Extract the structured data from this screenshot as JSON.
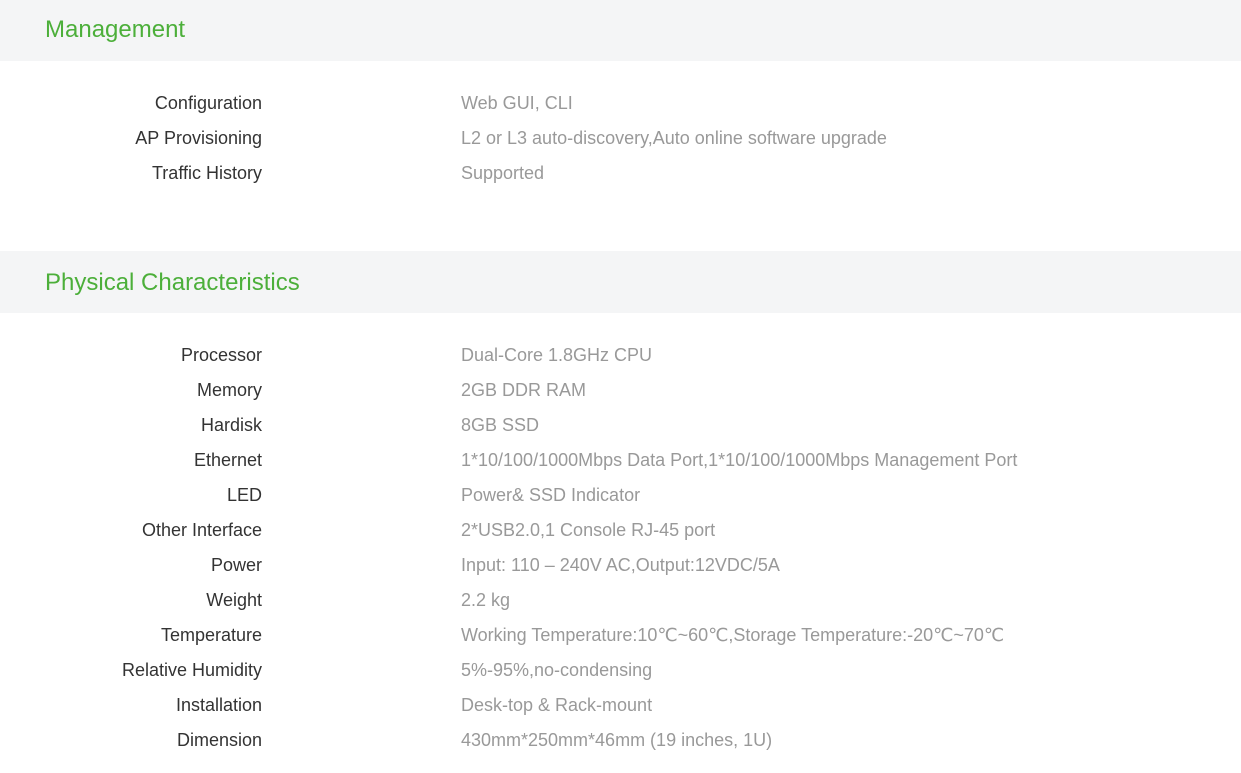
{
  "management": {
    "title": "Management",
    "rows": [
      {
        "label": "Configuration",
        "value": "Web GUI, CLI"
      },
      {
        "label": "AP Provisioning",
        "value": "L2 or L3 auto-discovery,Auto online software  upgrade"
      },
      {
        "label": "Traffic History",
        "value": "Supported"
      }
    ]
  },
  "physical": {
    "title": "Physical Characteristics",
    "rows": [
      {
        "label": "Processor",
        "value": "Dual-Core 1.8GHz CPU"
      },
      {
        "label": "Memory",
        "value": "2GB DDR RAM"
      },
      {
        "label": "Hardisk",
        "value": "8GB SSD"
      },
      {
        "label": "Ethernet",
        "value": "1*10/100/1000Mbps Data Port,1*10/100/1000Mbps Management Port"
      },
      {
        "label": "LED",
        "value": "Power& SSD Indicator"
      },
      {
        "label": "Other Interface",
        "value": "2*USB2.0,1 Console RJ-45 port"
      },
      {
        "label": "Power",
        "value": "Input: 110 – 240V AC,Output:12VDC/5A"
      },
      {
        "label": "Weight",
        "value": "2.2 kg"
      },
      {
        "label": "Temperature",
        "value": "Working Temperature:10℃~60℃,Storage Temperature:-20℃~70℃"
      },
      {
        "label": "Relative Humidity",
        "value": "5%-95%,no-condensing"
      },
      {
        "label": "Installation",
        "value": "Desk-top & Rack-mount"
      },
      {
        "label": "Dimension",
        "value": "430mm*250mm*46mm (19 inches, 1U)"
      }
    ]
  },
  "colors": {
    "accent": "#4caf3a",
    "header_bg": "#f4f5f6",
    "label": "#333333",
    "value": "#999999"
  }
}
